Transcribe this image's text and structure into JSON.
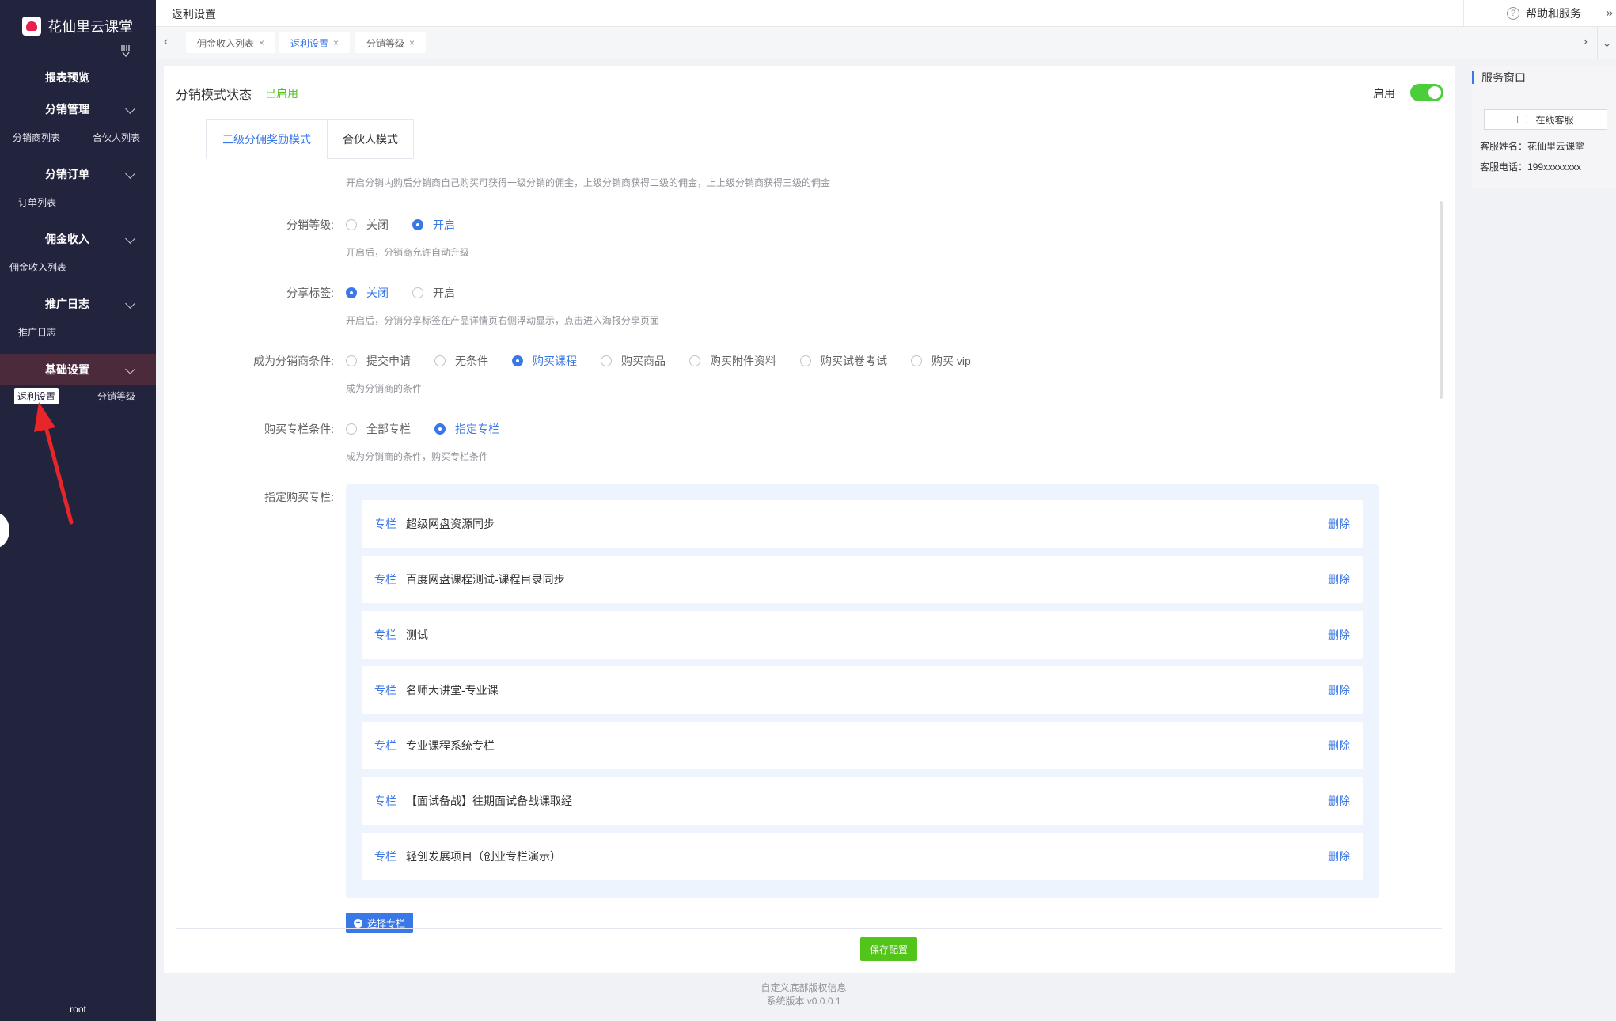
{
  "app": {
    "logo_text": "花仙里云课堂",
    "user": "root"
  },
  "sidebar": {
    "groups": [
      {
        "title": "报表预览",
        "children": []
      },
      {
        "title": "分销管理",
        "children": [
          "分销商列表",
          "合伙人列表"
        ]
      },
      {
        "title": "分销订单",
        "children": [
          "订单列表"
        ]
      },
      {
        "title": "佣金收入",
        "children": [
          "佣金收入列表"
        ]
      },
      {
        "title": "推广日志",
        "children": [
          "推广日志"
        ]
      },
      {
        "title": "基础设置",
        "children": [
          "返利设置",
          "分销等级"
        ]
      }
    ]
  },
  "header": {
    "breadcrumb": "返利设置",
    "help": "帮助和服务",
    "help_icon": "question-circle-icon",
    "expand_icon": "double-chevron-right-icon"
  },
  "tabs": [
    {
      "label": "佣金收入列表",
      "active": false
    },
    {
      "label": "返利设置",
      "active": true
    },
    {
      "label": "分销等级",
      "active": false
    }
  ],
  "main": {
    "status_title": "分销模式状态",
    "status_value": "已启用",
    "enable_label": "启用",
    "enabled": true,
    "mode_tabs": [
      "三级分佣奖励模式",
      "合伙人模式"
    ],
    "intro": "开启分销内购后分销商自己购买可获得一级分销的佣金，上级分销商获得二级的佣金，上上级分销商获得三级的佣金",
    "level": {
      "label": "分销等级:",
      "options": [
        "关闭",
        "开启"
      ],
      "selected": "开启",
      "hint": "开启后，分销商允许自动升级"
    },
    "share": {
      "label": "分享标签:",
      "options": [
        "关闭",
        "开启"
      ],
      "selected": "关闭",
      "hint": "开启后，分销分享标签在产品详情页右侧浮动显示，点击进入海报分享页面"
    },
    "condition": {
      "label": "成为分销商条件:",
      "options": [
        "提交申请",
        "无条件",
        "购买课程",
        "购买商品",
        "购买附件资料",
        "购买试卷考试",
        "购买 vip"
      ],
      "selected": "购买课程",
      "hint": "成为分销商的条件"
    },
    "column_condition": {
      "label": "购买专栏条件:",
      "options": [
        "全部专栏",
        "指定专栏"
      ],
      "selected": "指定专栏",
      "hint": "成为分销商的条件，购买专栏条件"
    },
    "columns": {
      "label": "指定购买专栏:",
      "tag": "专栏",
      "delete": "删除",
      "items": [
        "超级网盘资源同步",
        "百度网盘课程测试-课程目录同步",
        "测试",
        "名师大讲堂-专业课",
        "专业课程系统专栏",
        "【面试备战】往期面试备战课取经",
        "轻创发展项目（创业专栏演示）"
      ]
    },
    "select_button": "选择专栏",
    "save_button": "保存配置"
  },
  "footer": {
    "copyright": "自定义底部版权信息",
    "version": "系统版本 v0.0.0.1"
  },
  "service": {
    "title": "服务窗口",
    "online_button": "在线客服",
    "name_line": "客服姓名：花仙里云课堂",
    "phone_line": "客服电话：199xxxxxxxx"
  },
  "colors": {
    "sidebar_bg": "#22233d",
    "accent_blue": "#3b78e7",
    "success_green": "#52c41a",
    "toggle_green": "#4ccd3b",
    "annotation_red": "#e8262a"
  }
}
